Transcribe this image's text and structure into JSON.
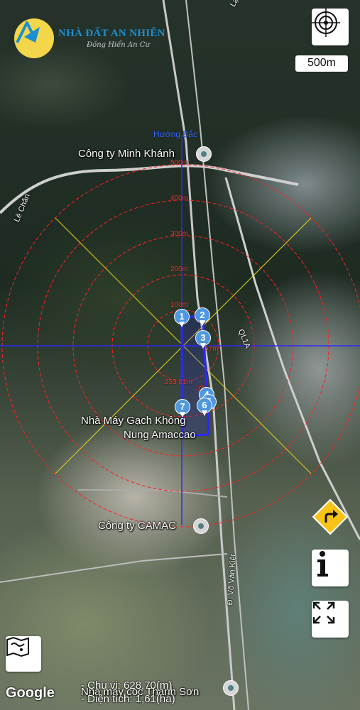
{
  "brand": {
    "name": "NHÀ ĐẤT AN NHIÊN",
    "slogan": "Đồng Hiển An Cư",
    "colors": {
      "badge": "#f3d64a",
      "name": "#1b8fd1"
    }
  },
  "scale": {
    "label": "500m"
  },
  "compass": {
    "label": "Hướng Bắc"
  },
  "rings": [
    {
      "label": "500m"
    },
    {
      "label": "400m"
    },
    {
      "label": "300m"
    },
    {
      "label": "200m"
    },
    {
      "label": "100m"
    }
  ],
  "places": [
    {
      "name": "Công ty Minh Khánh"
    },
    {
      "name": "Nhà Máy Gạch Không",
      "name2": "Nung Amaccao"
    },
    {
      "name": "Công ty CAMAC"
    },
    {
      "name": "Nhà máy cọc Thanh Sơn"
    }
  ],
  "roads": [
    {
      "name": "Lạt Sơn"
    },
    {
      "name": "Lê Chân"
    },
    {
      "name": "QL1A"
    },
    {
      "name": "Đ. Võ Văn Kiệt"
    }
  ],
  "markers": [
    {
      "number": "1"
    },
    {
      "number": "2"
    },
    {
      "number": "3"
    },
    {
      "number": "4"
    },
    {
      "number": "5"
    },
    {
      "number": "6"
    },
    {
      "number": "7"
    }
  ],
  "segment_labels": [
    "253,01m",
    "32m",
    "57m"
  ],
  "stats": {
    "perimeter": "- Chu vi: 628,70(m)",
    "area": "- Diện tích: 1,61(ha)"
  },
  "attribution": "Google",
  "icons": {
    "locate": "crosshair-icon",
    "direction": "turn-right-icon",
    "info": "info-icon",
    "expand": "expand-icon",
    "map_type": "map-type-icon"
  },
  "overlay_colors": {
    "rings": "#ff2020",
    "axes": "#2a2aff",
    "diagonals": "#e0d020",
    "parcel": "#2a2aff"
  }
}
